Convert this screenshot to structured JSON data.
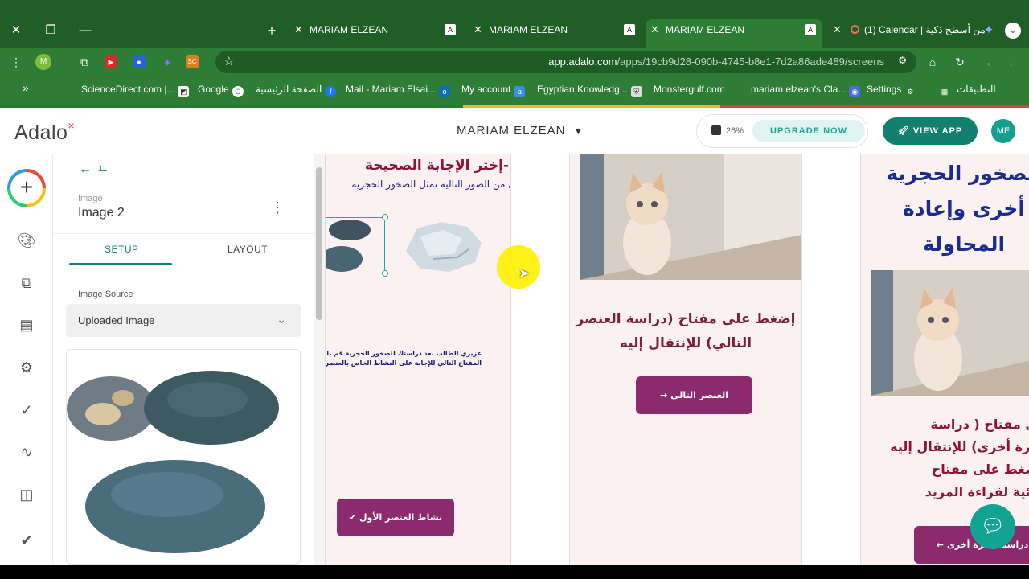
{
  "browser": {
    "tabs": [
      {
        "title": "MARIAM ELZEAN",
        "favicon": "A"
      },
      {
        "title": "MARIAM ELZEAN",
        "favicon": "A"
      },
      {
        "title": "MARIAM ELZEAN",
        "favicon": "A",
        "active": true
      },
      {
        "title": "(1) Calendar | من أسطح ذكية",
        "favicon": "calendar"
      }
    ],
    "new_tab_symbol": "+",
    "url_host": "app.adalo.com",
    "url_path": "/apps/19cb9d28-090b-4745-b8e1-7d2a86ade489/screens",
    "profile_letter": "M",
    "bookmarks": [
      "ScienceDirect.com |...",
      "Google",
      "الصفحة الرئيسية",
      "Mail - Mariam.Elsai...",
      "My account",
      "Egyptian Knowledg...",
      "Monstergulf.com",
      "mariam elzean's Cla...",
      "Settings",
      "التطبيقات"
    ],
    "bookmarks_overflow": "»"
  },
  "header": {
    "logo": "Adalo",
    "app_name": "MARIAM ELZEAN",
    "progress_percent": "26%",
    "upgrade_label": "UPGRADE NOW",
    "view_app_label": "VIEW APP",
    "avatar_initials": "ME"
  },
  "panel": {
    "back_count": "11",
    "component_type": "Image",
    "component_name": "Image 2",
    "tabs": [
      "SETUP",
      "LAYOUT"
    ],
    "active_tab": "SETUP",
    "image_source_label": "Image Source",
    "image_source_value": "Uploaded Image"
  },
  "canvas": {
    "screen1": {
      "title": "-إختر الإجابة الصحيحة",
      "subtitle": "أي من الصور التالية تمثل الصخور الحجرية",
      "paragraph_line1": "عزيزي الطالب بعد دراستك للصخور الحجرية قم بالضغط على",
      "paragraph_line2": "المفتاح التالي للإجابة على النشاط الخاص بالعنصر",
      "button_label": "نشاط العنصر الأول"
    },
    "screen2": {
      "text": "إضغط على مفتاح (دراسة العنصر التالي) للإنتقال إليه",
      "button_label": "العنصر التالي"
    },
    "screen3": {
      "title": "الصخور الحجرية أخرى وإعادة المحاولة",
      "text_line1": "على مفتاح ( دراسة",
      "text_line2": "صخرة أخرى) للإنتقال إليه",
      "text_line3": "بالضغط على مفتاح",
      "text_line4": "إثرائية لقراءة المزيد",
      "button_label": "دراسة صخرة أخرى"
    }
  },
  "colors": {
    "chrome_dark": "#1f5e26",
    "chrome": "#2d7d37",
    "adalo_teal": "#12806f",
    "button_purple": "#8b2a6c",
    "title_maroon": "#8a1538",
    "title_blue": "#1a2d8a"
  }
}
